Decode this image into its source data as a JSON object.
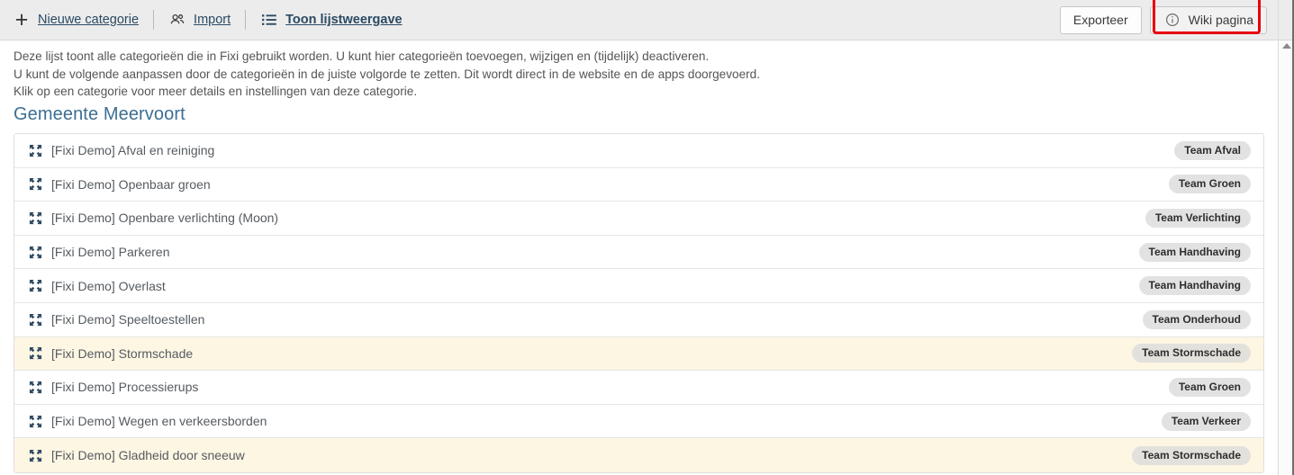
{
  "toolbar": {
    "actions": [
      {
        "icon": "plus-icon",
        "label": "Nieuwe categorie",
        "bold": false
      },
      {
        "icon": "users-icon",
        "label": "Import",
        "bold": false
      },
      {
        "icon": "list-icon",
        "label": "Toon lijstweergave",
        "bold": true
      }
    ],
    "export_label": "Exporteer",
    "wiki_label": "Wiki pagina",
    "wiki_icon": "info-circle-icon",
    "highlight_color": "#e8000c"
  },
  "intro": {
    "line1": "Deze lijst toont alle categorieën die in Fixi gebruikt worden. U kunt hier categorieën toevoegen, wijzigen en (tijdelijk) deactiveren.",
    "line2": "U kunt de volgende aanpassen door de categorieën in de juiste volgorde te zetten. Dit wordt direct in de website en de apps doorgevoerd.",
    "line3": "Klik op een categorie voor meer details en instellingen van deze categorie."
  },
  "section": {
    "title": "Gemeente Meervoort",
    "title_color": "#3d6e93"
  },
  "categories": [
    {
      "drag_icon": "move-icon",
      "label": "[Fixi Demo] Afval en reiniging",
      "team": "Team Afval",
      "highlighted": false
    },
    {
      "drag_icon": "move-icon",
      "label": "[Fixi Demo] Openbaar groen",
      "team": "Team Groen",
      "highlighted": false
    },
    {
      "drag_icon": "move-icon",
      "label": "[Fixi Demo] Openbare verlichting (Moon)",
      "team": "Team Verlichting",
      "highlighted": false
    },
    {
      "drag_icon": "move-icon",
      "label": "[Fixi Demo] Parkeren",
      "team": "Team Handhaving",
      "highlighted": false
    },
    {
      "drag_icon": "move-icon",
      "label": "[Fixi Demo] Overlast",
      "team": "Team Handhaving",
      "highlighted": false
    },
    {
      "drag_icon": "move-icon",
      "label": "[Fixi Demo] Speeltoestellen",
      "team": "Team Onderhoud",
      "highlighted": false
    },
    {
      "drag_icon": "move-icon",
      "label": "[Fixi Demo] Stormschade",
      "team": "Team Stormschade",
      "highlighted": true
    },
    {
      "drag_icon": "move-icon",
      "label": "[Fixi Demo] Processierups",
      "team": "Team Groen",
      "highlighted": false
    },
    {
      "drag_icon": "move-icon",
      "label": "[Fixi Demo] Wegen en verkeersborden",
      "team": "Team Verkeer",
      "highlighted": false
    },
    {
      "drag_icon": "move-icon",
      "label": "[Fixi Demo] Gladheid door sneeuw",
      "team": "Team Stormschade",
      "highlighted": true
    }
  ],
  "scrollbar": {
    "arrow_up": "scroll-up-arrow"
  }
}
